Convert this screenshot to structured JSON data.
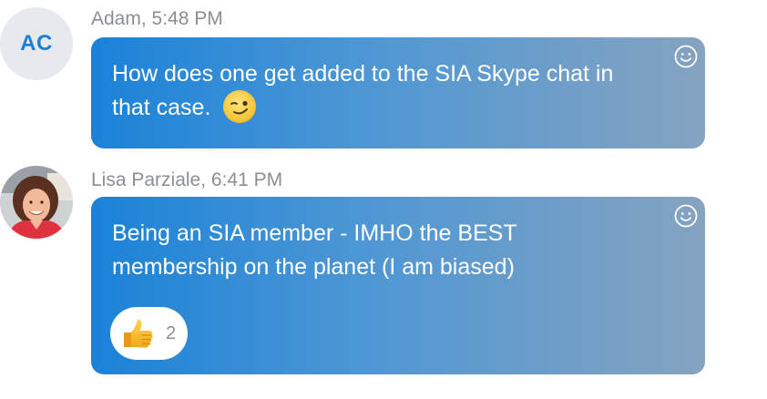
{
  "messages": [
    {
      "author": "Adam",
      "time": "5:48 PM",
      "avatar_initials": "AC",
      "text": "How does one get added to the SIA Skype chat in that case.",
      "inline_emoji": "wink-emoji"
    },
    {
      "author": "Lisa Parziale",
      "time": "6:41 PM",
      "avatar": "profile-photo",
      "line1": "Being an SIA member - IMHO the BEST",
      "line2": "membership on the planet (I am biased)",
      "reaction": {
        "icon": "thumbs-up-icon",
        "count": "2"
      }
    }
  ],
  "colors": {
    "bubble_start": "#1a82d8",
    "bubble_end": "#86a3c0",
    "meta_text": "#8a8f96",
    "initials_text": "#1c7fd4",
    "initials_bg": "#e6e9ee"
  }
}
